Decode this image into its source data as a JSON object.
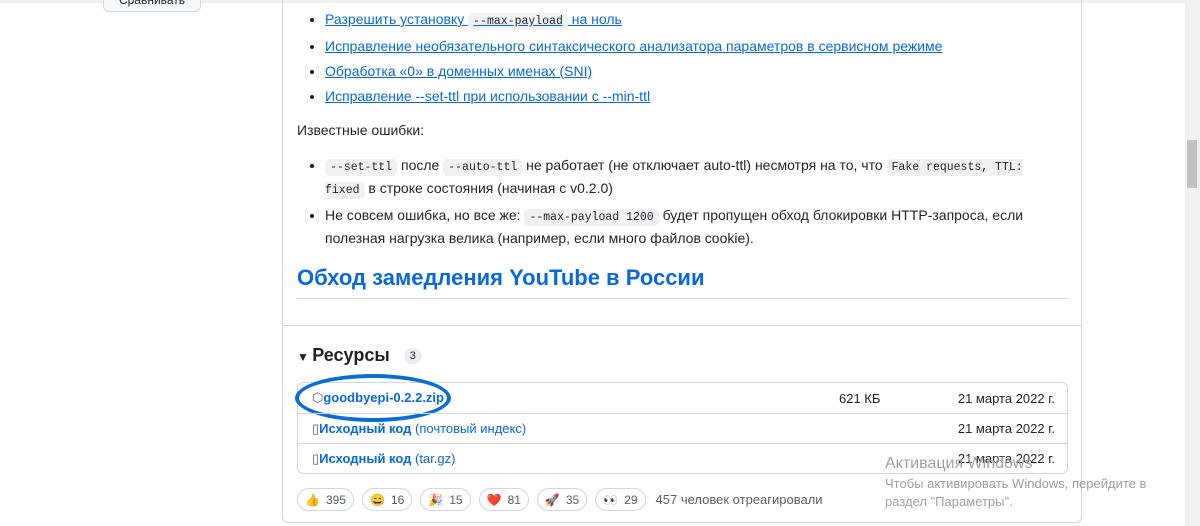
{
  "sidebar": {
    "compare_button": "Сравнивать"
  },
  "fixes": [
    {
      "pre": "Разрешить установку ",
      "code": "--max-payload",
      "post": " на ноль"
    },
    {
      "pre": "Исправление необязательного синтаксического анализатора параметров в сервисном режиме"
    },
    {
      "pre": "Обработка «0» в доменных именах (SNI)"
    },
    {
      "pre": "Исправление --set-ttl при использовании с --min-ttl"
    }
  ],
  "known_errors_label": "Известные ошибки:",
  "errors": [
    {
      "c1": "--set-ttl",
      "t1": " после ",
      "c2": "--auto-ttl",
      "t2": " не работает (не отключает auto-ttl) несмотря на то, что ",
      "c3": "Fake requests, TTL: fixed",
      "t3": " в строке состояния (начиная с v0.2.0)"
    },
    {
      "t1": "Не совсем ошибка, но все же: ",
      "c1": "--max-payload 1200",
      "t2": " будет пропущен обход блокировки HTTP-запроса, если полезная нагрузка велика (например, если много файлов cookie)."
    }
  ],
  "heading": "Обход замедления YouTube в России",
  "resources": {
    "title": "Ресурсы",
    "count": "3",
    "assets": [
      {
        "name": "goodbyepi-0.2.2.zip",
        "size": "621 КБ",
        "date": "21 марта 2022 г."
      },
      {
        "name": "Исходный код",
        "suffix": " (почтовый индекс)",
        "date": "21 марта 2022 г."
      },
      {
        "name": "Исходный код",
        "suffix": " (tar.gz)",
        "date": "21 марта 2022 г."
      }
    ]
  },
  "reactions": [
    {
      "emoji": "👍",
      "count": "395"
    },
    {
      "emoji": "😄",
      "count": "16"
    },
    {
      "emoji": "🎉",
      "count": "15"
    },
    {
      "emoji": "❤️",
      "count": "81"
    },
    {
      "emoji": "🚀",
      "count": "35"
    },
    {
      "emoji": "👀",
      "count": "29"
    }
  ],
  "reactions_summary": "457 человек отреагировали",
  "watermark": {
    "title": "Активация Windows",
    "line1": "Чтобы активировать Windows, перейдите в",
    "line2": "раздел \"Параметры\"."
  }
}
